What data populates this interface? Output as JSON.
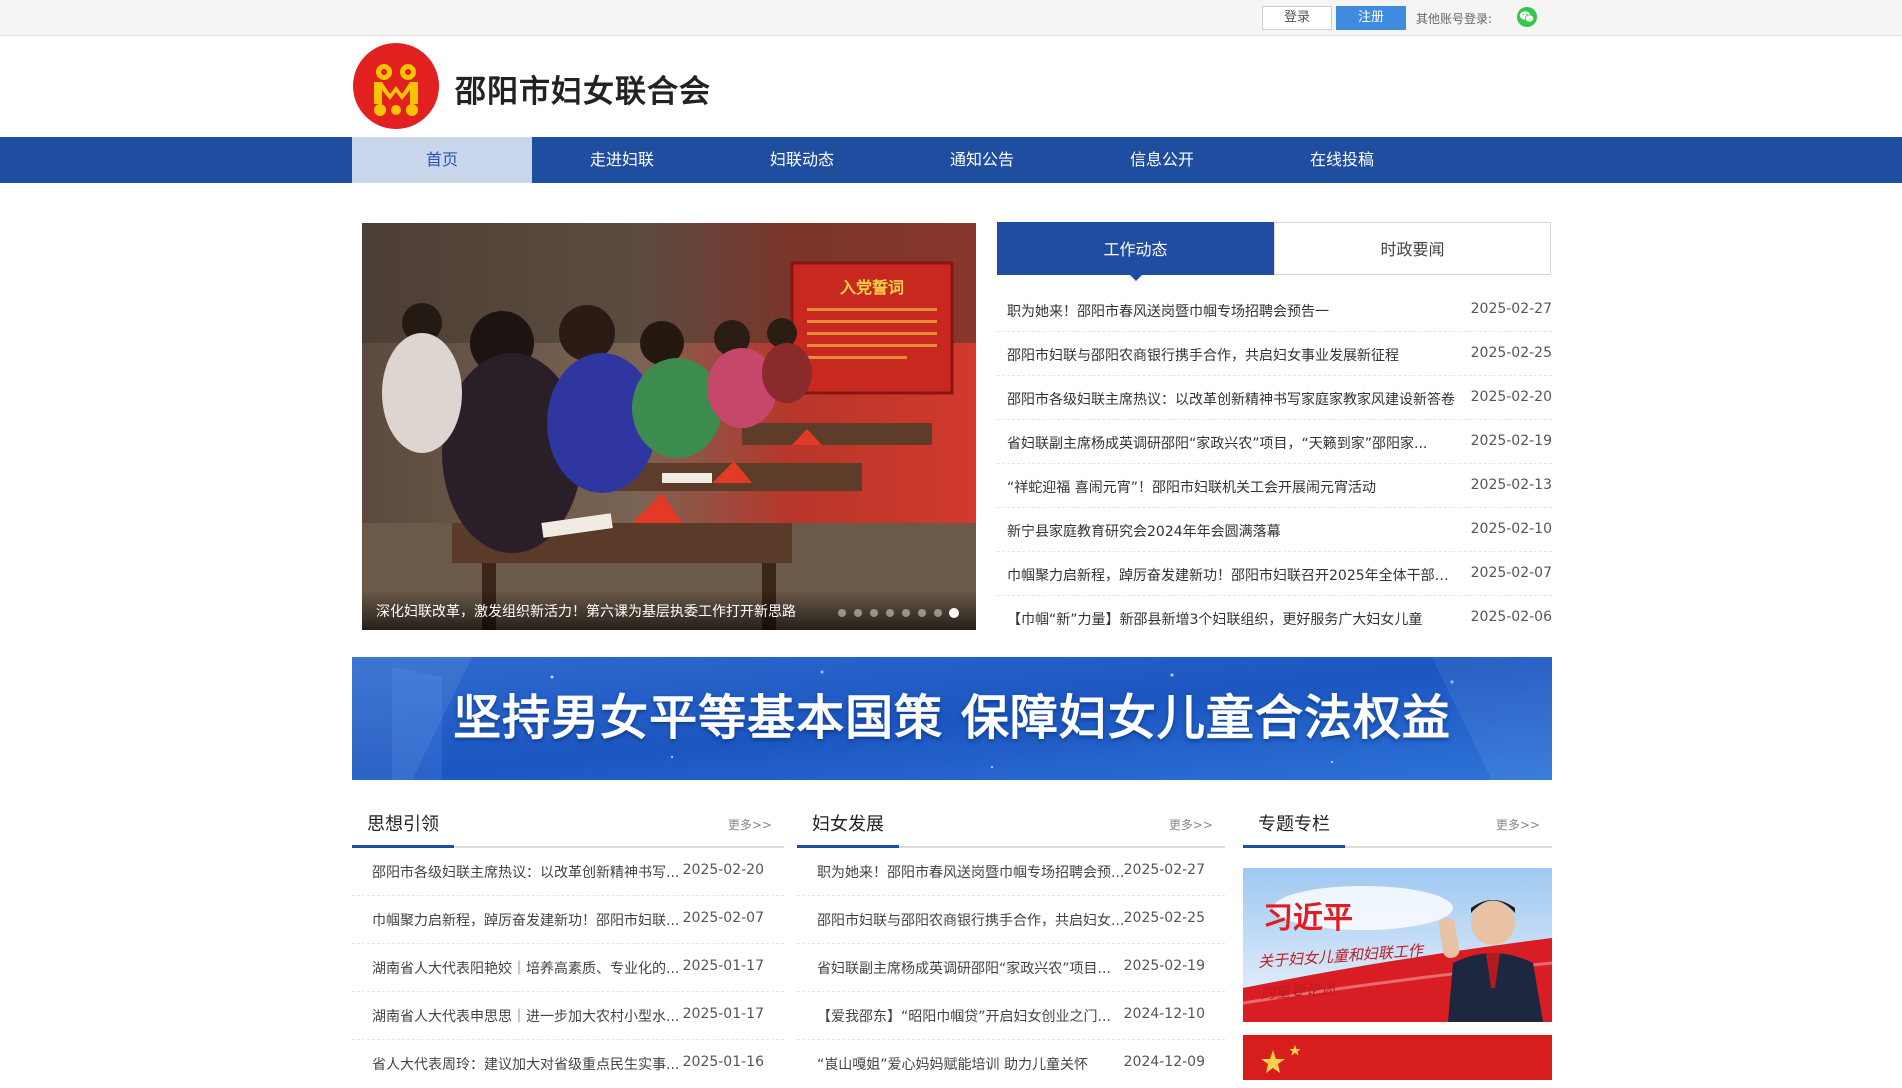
{
  "topbar": {
    "login_label": "登录",
    "register_label": "注册",
    "other_login_label": "其他账号登录:",
    "wechat_icon": "wechat-icon"
  },
  "header": {
    "site_title": "邵阳市妇女联合会",
    "logo_icon": "women-federation-emblem"
  },
  "nav": {
    "items": [
      {
        "label": "首页",
        "active": true
      },
      {
        "label": "走进妇联"
      },
      {
        "label": "妇联动态"
      },
      {
        "label": "通知公告"
      },
      {
        "label": "信息公开"
      },
      {
        "label": "在线投稿"
      }
    ]
  },
  "slider": {
    "caption": "深化妇联改革，激发组织新活力！第六课为基层执委工作打开新思路",
    "dot_count": 8,
    "active_dot": 8,
    "sign_text": "入党誓词"
  },
  "news_panel": {
    "tabs": [
      {
        "label": "工作动态",
        "active": true
      },
      {
        "label": "时政要闻"
      }
    ],
    "items": [
      {
        "title": "职为她来！邵阳市春风送岗暨巾帼专场招聘会预告一",
        "date": "2025-02-27"
      },
      {
        "title": "邵阳市妇联与邵阳农商银行携手合作，共启妇女事业发展新征程",
        "date": "2025-02-25"
      },
      {
        "title": "邵阳市各级妇联主席热议：以改革创新精神书写家庭家教家风建设新答卷",
        "date": "2025-02-20"
      },
      {
        "title": "省妇联副主席杨成英调研邵阳“家政兴农”项目，“天籁到家”邵阳家...",
        "date": "2025-02-19"
      },
      {
        "title": "“祥蛇迎福 喜闹元宵”！邵阳市妇联机关工会开展闹元宵活动",
        "date": "2025-02-13"
      },
      {
        "title": "新宁县家庭教育研究会2024年年会圆满落幕",
        "date": "2025-02-10"
      },
      {
        "title": "巾帼聚力启新程，踔厉奋发建新功！邵阳市妇联召开2025年全体干部职...",
        "date": "2025-02-07"
      },
      {
        "title": "【巾帼“新”力量】新邵县新增3个妇联组织，更好服务广大妇女儿童",
        "date": "2025-02-06"
      }
    ]
  },
  "banner": {
    "text": "坚持男女平等基本国策  保障妇女儿童合法权益"
  },
  "columns": [
    {
      "title": "思想引领",
      "more": "更多>>",
      "items": [
        {
          "title": "邵阳市各级妇联主席热议：以改革创新精神书写...",
          "date": "2025-02-20"
        },
        {
          "title": "巾帼聚力启新程，踔厉奋发建新功！邵阳市妇联...",
          "date": "2025-02-07"
        },
        {
          "title": "湖南省人大代表阳艳姣｜培养高素质、专业化的...",
          "date": "2025-01-17"
        },
        {
          "title": "湖南省人大代表申思思｜进一步加大农村小型水...",
          "date": "2025-01-17"
        },
        {
          "title": "省人大代表周玲：建议加大对省级重点民生实事...",
          "date": "2025-01-16"
        }
      ]
    },
    {
      "title": "妇女发展",
      "more": "更多>>",
      "items": [
        {
          "title": "职为她来！邵阳市春风送岗暨巾帼专场招聘会预...",
          "date": "2025-02-27"
        },
        {
          "title": "邵阳市妇联与邵阳农商银行携手合作，共启妇女...",
          "date": "2025-02-25"
        },
        {
          "title": "省妇联副主席杨成英调研邵阳“家政兴农”项目...",
          "date": "2025-02-19"
        },
        {
          "title": "【爱我邵东】“昭阳巾帼贷”开启妇女创业之门...",
          "date": "2024-12-10"
        },
        {
          "title": "“崀山嘎姐”爱心妈妈赋能培训 助力儿童关怀",
          "date": "2024-12-09"
        }
      ]
    },
    {
      "title": "专题专栏",
      "more": "更多>>",
      "feature_name": "习近平",
      "feature_sub": "关于妇女儿童和妇联工作的重要论述"
    }
  ],
  "colors": {
    "nav_blue": "#1f4ea0",
    "register_blue": "#3f8bde",
    "logo_red": "#e32020",
    "logo_yellow": "#f7c500"
  }
}
